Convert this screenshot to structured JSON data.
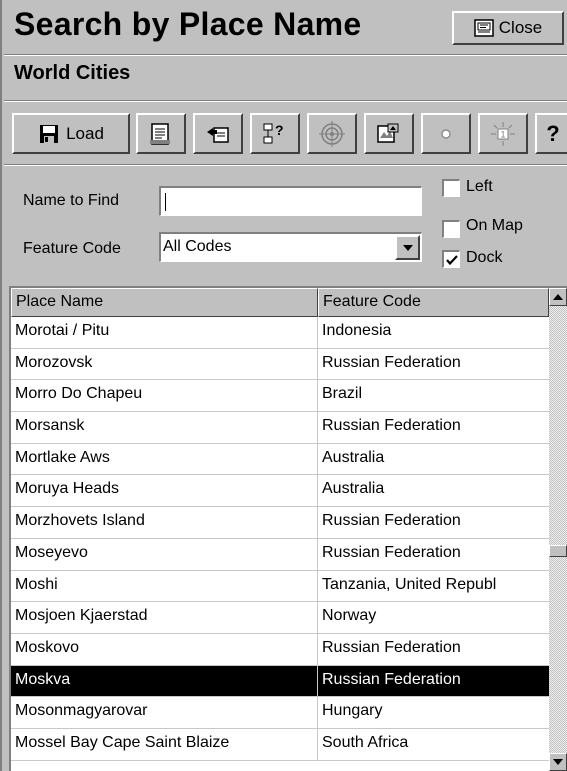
{
  "window": {
    "title": "Search by Place Name",
    "close_label": "Close",
    "subtitle": "World Cities"
  },
  "toolbar": {
    "load_label": "Load",
    "icons": [
      "load-icon",
      "print-list-icon",
      "copy-icon",
      "tree-help-icon",
      "target-icon",
      "map-view-icon",
      "dot-icon",
      "locate-icon",
      "help-icon"
    ],
    "help_label": "?"
  },
  "find": {
    "name_label": "Name to Find",
    "name_value": "",
    "feature_label": "Feature Code",
    "feature_value": "All Codes"
  },
  "options": [
    {
      "label": "Left",
      "checked": false
    },
    {
      "label": "On Map",
      "checked": false
    },
    {
      "label": "Dock",
      "checked": true
    }
  ],
  "table": {
    "columns": [
      "Place Name",
      "Feature Code"
    ],
    "rows": [
      {
        "name": "Morotai / Pitu",
        "code": "Indonesia"
      },
      {
        "name": "Morozovsk",
        "code": "Russian Federation"
      },
      {
        "name": "Morro Do Chapeu",
        "code": "Brazil"
      },
      {
        "name": "Morsansk",
        "code": "Russian Federation"
      },
      {
        "name": "Mortlake Aws",
        "code": "Australia"
      },
      {
        "name": "Moruya Heads",
        "code": "Australia"
      },
      {
        "name": "Morzhovets Island",
        "code": "Russian Federation"
      },
      {
        "name": "Moseyevo",
        "code": "Russian Federation"
      },
      {
        "name": "Moshi",
        "code": "Tanzania, United Republ"
      },
      {
        "name": "Mosjoen Kjaerstad",
        "code": "Norway"
      },
      {
        "name": "Moskovo",
        "code": "Russian Federation"
      },
      {
        "name": "Moskva",
        "code": "Russian Federation"
      },
      {
        "name": "Mosonmagyarovar",
        "code": "Hungary"
      },
      {
        "name": "Mossel Bay Cape Saint Blaize",
        "code": "South Africa"
      }
    ],
    "selected_index": 11,
    "scroll_position": 0.55
  }
}
